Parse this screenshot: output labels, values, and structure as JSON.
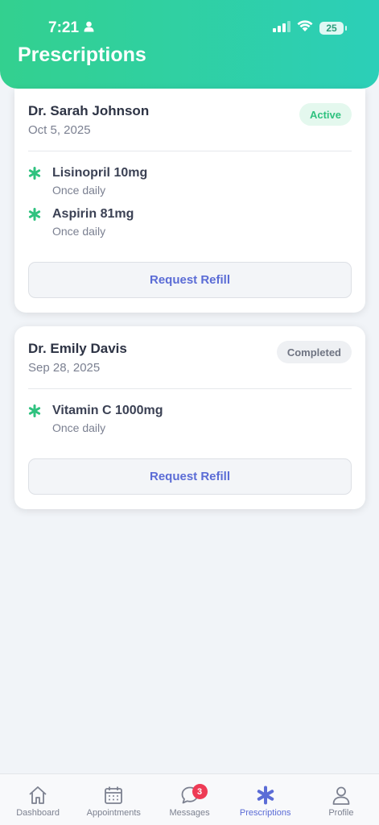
{
  "status_bar": {
    "time": "7:21",
    "battery": "25"
  },
  "header": {
    "title": "Prescriptions"
  },
  "prescriptions": [
    {
      "doctor": "Dr. Sarah Johnson",
      "date": "Oct 5, 2025",
      "status": "Active",
      "medications": [
        {
          "name": "Lisinopril 10mg",
          "frequency": "Once daily"
        },
        {
          "name": "Aspirin 81mg",
          "frequency": "Once daily"
        }
      ],
      "action_label": "Request Refill"
    },
    {
      "doctor": "Dr. Emily Davis",
      "date": "Sep 28, 2025",
      "status": "Completed",
      "medications": [
        {
          "name": "Vitamin C 1000mg",
          "frequency": "Once daily"
        }
      ],
      "action_label": "Request Refill"
    }
  ],
  "tabbar": {
    "items": [
      {
        "label": "Dashboard",
        "icon": "home-icon"
      },
      {
        "label": "Appointments",
        "icon": "calendar-icon"
      },
      {
        "label": "Messages",
        "icon": "chat-icon",
        "badge": "3"
      },
      {
        "label": "Prescriptions",
        "icon": "asterisk-icon",
        "active": true
      },
      {
        "label": "Profile",
        "icon": "user-icon"
      }
    ]
  },
  "colors": {
    "header_gradient_start": "#33d08f",
    "header_gradient_end": "#2ccfb8",
    "accent": "#5b6cd6",
    "active_green": "#2fc27f",
    "badge_red": "#ee3b55"
  }
}
